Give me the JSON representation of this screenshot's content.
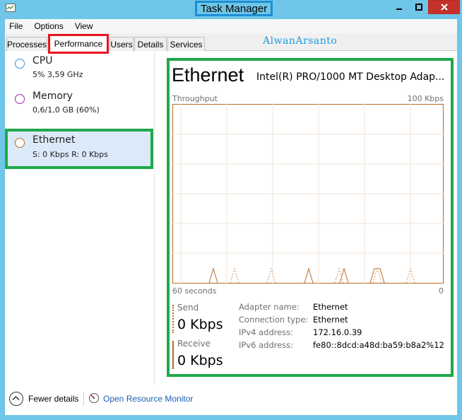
{
  "window": {
    "title": "Task Manager"
  },
  "menu": [
    "File",
    "Options",
    "View"
  ],
  "tabs": [
    "Processes",
    "Performance",
    "Users",
    "Details",
    "Services"
  ],
  "active_tab": "Performance",
  "watermark": "AlwanArsanto",
  "resources": [
    {
      "name": "CPU",
      "detail": "5% 3,59 GHz",
      "color": "#3a8fd0"
    },
    {
      "name": "Memory",
      "detail": "0,6/1,0 GB (60%)",
      "color": "#9b2aa8"
    },
    {
      "name": "Ethernet",
      "detail": "S: 0 Kbps R: 0 Kbps",
      "color": "#b86b25"
    }
  ],
  "selected_resource": "Ethernet",
  "detail": {
    "heading": "Ethernet",
    "adapter": "Intel(R) PRO/1000 MT Desktop Adap...",
    "graph_label": "Throughput",
    "graph_max": "100 Kbps",
    "axis_left": "60 seconds",
    "axis_right": "0",
    "send_label": "Send",
    "send_value": "0 Kbps",
    "receive_label": "Receive",
    "receive_value": "0 Kbps",
    "properties": [
      {
        "label": "Adapter name:",
        "value": "Ethernet"
      },
      {
        "label": "Connection type:",
        "value": "Ethernet"
      },
      {
        "label": "IPv4 address:",
        "value": "172.16.0.39"
      },
      {
        "label": "IPv6 address:",
        "value": "fe80::8dcd:a48d:ba59:b8a2%12"
      }
    ]
  },
  "footer": {
    "fewer_details": "Fewer details",
    "resource_monitor": "Open Resource Monitor"
  },
  "colors": {
    "accent": "#1fa84a",
    "highlight": "#e8141e",
    "title_box": "#1c8fd6",
    "ethernet": "#b86b25"
  }
}
